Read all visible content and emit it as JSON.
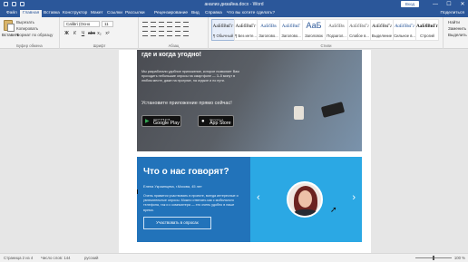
{
  "title_bar": {
    "doc_title": "анализ дизайна.docx  -  Word",
    "login_label": "Вход",
    "controls": [
      "—",
      "☐",
      "✕"
    ]
  },
  "tabs": [
    "Файл",
    "Главная",
    "Вставка",
    "Конструктор",
    "Макет",
    "Ссылки",
    "Рассылки",
    "Рецензирование",
    "Вид",
    "Справка",
    "Что вы хотите сделать?"
  ],
  "share_label": "Поделиться",
  "ribbon": {
    "paste_label": "Вставить",
    "clipboard_items": [
      "Вырезать",
      "Копировать",
      "Формат по образцу"
    ],
    "font_name": "Calibri (Осно",
    "font_size": "11",
    "format_buttons": [
      "Ж",
      "К",
      "Ч",
      "abc",
      "x₂",
      "x²"
    ],
    "styles": [
      {
        "preview": "АаБбВвГг",
        "name": "¶ Обычный"
      },
      {
        "preview": "АаБбВвГг",
        "name": "¶ Без инте..."
      },
      {
        "preview": "АаБбВв",
        "name": "Заголово..."
      },
      {
        "preview": "АаБбВвГ",
        "name": "Заголово..."
      },
      {
        "preview": "АаБ",
        "name": "Заголовок"
      },
      {
        "preview": "АаБбВв",
        "name": "Подзагол..."
      },
      {
        "preview": "АаБбВвГг",
        "name": "Слабое в..."
      },
      {
        "preview": "АаБбВвГг",
        "name": "Выделение"
      },
      {
        "preview": "АаБбВвГг",
        "name": "Сильное в..."
      },
      {
        "preview": "АаБбВвГг",
        "name": "Строгий"
      }
    ],
    "editing": [
      "Найти",
      "Заменить",
      "Выделить"
    ],
    "group_labels": {
      "clipboard": "Буфер обмена",
      "font": "Шрифт",
      "paragraph": "Абзац",
      "styles": "Стили",
      "editing": "Редактирование"
    }
  },
  "document": {
    "hero": {
      "title": "где и когда угодно!",
      "text": "Мы разработали удобное приложение, которое позволяет Вам проходить небольшие опросы на смартфоне — 3–5 минут в любом месте, даже на прогулке, на отдыхе и по пути.",
      "cta": "Установите приложение прямо сейчас!",
      "google": {
        "small": "ДОСТУПНО В",
        "big": "Google Play"
      },
      "apple": {
        "small": "Загрузите в",
        "big": "App Store"
      }
    },
    "reviews": {
      "title": "Что о нас говорят?",
      "author": "Елена Украинцева, г.Москва, 45 лет",
      "text": "Очень нравится участвовать в проекте, всегда интересные и увлекательные опросы. Можно отвечать как с мобильного телефона, так и с компьютера — это очень удобно в наше время.",
      "button": "Участвовать в опросах",
      "prev_arrow": "‹",
      "next_arrow": "›"
    }
  },
  "status_bar": {
    "page": "Страница 2 из 4",
    "words": "Число слов: 144",
    "language": "русский",
    "zoom": "100 %"
  }
}
